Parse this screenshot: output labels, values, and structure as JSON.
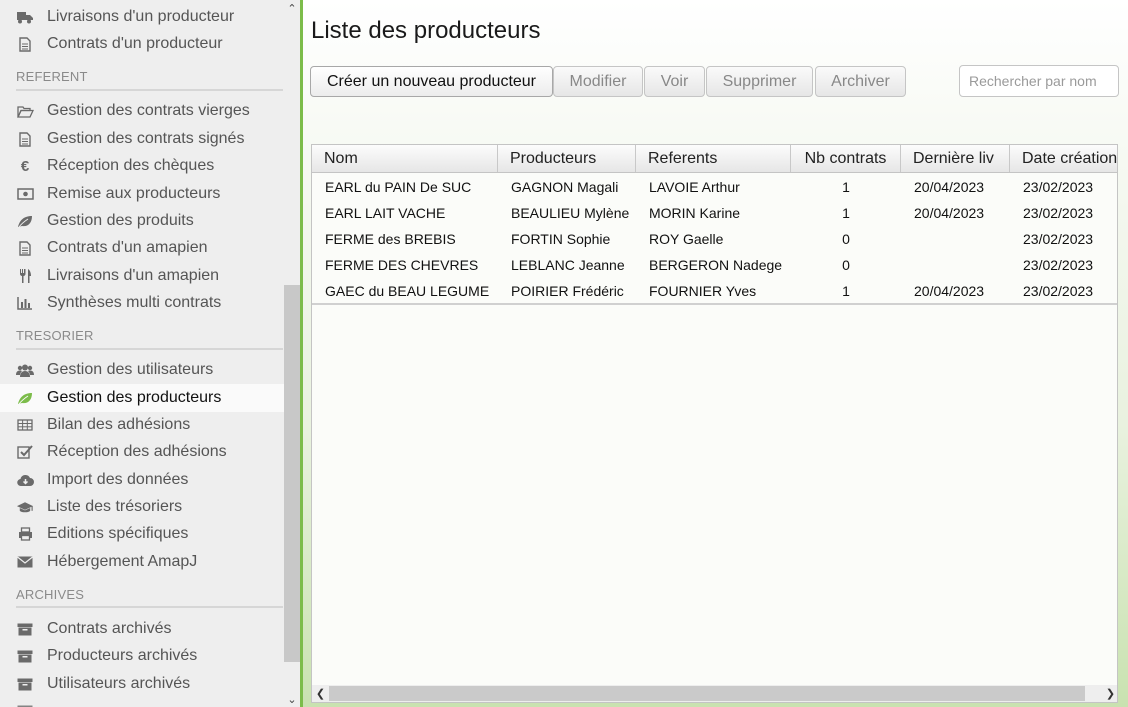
{
  "sidebar": {
    "top_items": [
      {
        "label": "Livraisons d'un producteur",
        "icon": "truck-icon"
      },
      {
        "label": "Contrats d'un producteur",
        "icon": "document-icon"
      }
    ],
    "sections": [
      {
        "title": "REFERENT",
        "items": [
          {
            "label": "Gestion des contrats vierges",
            "icon": "folder-open-icon"
          },
          {
            "label": "Gestion des contrats signés",
            "icon": "document-icon"
          },
          {
            "label": "Réception des chèques",
            "icon": "euro-icon"
          },
          {
            "label": "Remise aux producteurs",
            "icon": "money-icon"
          },
          {
            "label": "Gestion des produits",
            "icon": "leaf-icon"
          },
          {
            "label": "Contrats d'un amapien",
            "icon": "document-icon"
          },
          {
            "label": "Livraisons d'un amapien",
            "icon": "cutlery-icon"
          },
          {
            "label": "Synthèses multi contrats",
            "icon": "bar-chart-icon"
          }
        ]
      },
      {
        "title": "TRESORIER",
        "items": [
          {
            "label": "Gestion des utilisateurs",
            "icon": "users-icon"
          },
          {
            "label": "Gestion des producteurs",
            "icon": "leaf-icon",
            "active": true
          },
          {
            "label": "Bilan des adhésions",
            "icon": "table-icon"
          },
          {
            "label": "Réception des adhésions",
            "icon": "checkbox-icon"
          },
          {
            "label": "Import des données",
            "icon": "cloud-download-icon"
          },
          {
            "label": "Liste des trésoriers",
            "icon": "graduation-cap-icon"
          },
          {
            "label": "Editions spécifiques",
            "icon": "print-icon"
          },
          {
            "label": "Hébergement AmapJ",
            "icon": "envelope-icon"
          }
        ]
      },
      {
        "title": "ARCHIVES",
        "items": [
          {
            "label": "Contrats archivés",
            "icon": "archive-icon"
          },
          {
            "label": "Producteurs archivés",
            "icon": "archive-icon"
          },
          {
            "label": "Utilisateurs archivés",
            "icon": "archive-icon"
          }
        ]
      }
    ],
    "accent_color": "#7cbc4a"
  },
  "main": {
    "title": "Liste des producteurs",
    "buttons": {
      "create": "Créer un nouveau producteur",
      "edit": "Modifier",
      "view": "Voir",
      "delete": "Supprimer",
      "archive": "Archiver"
    },
    "search": {
      "placeholder": "Rechercher par nom",
      "value": ""
    },
    "table": {
      "columns": [
        "Nom",
        "Producteurs",
        "Referents",
        "Nb contrats",
        "Dernière liv",
        "Date création"
      ],
      "rows": [
        [
          "EARL du PAIN De SUC",
          "GAGNON Magali",
          "LAVOIE Arthur",
          "1",
          "20/04/2023",
          "23/02/2023"
        ],
        [
          "EARL LAIT VACHE",
          "BEAULIEU Mylène",
          "MORIN Karine",
          "1",
          "20/04/2023",
          "23/02/2023"
        ],
        [
          "FERME des BREBIS",
          "FORTIN Sophie",
          "ROY Gaelle",
          "0",
          "",
          "23/02/2023"
        ],
        [
          "FERME DES CHEVRES",
          "LEBLANC Jeanne",
          "BERGERON Nadege",
          "0",
          "",
          "23/02/2023"
        ],
        [
          "GAEC du BEAU LEGUME",
          "POIRIER Frédéric",
          "FOURNIER Yves",
          "1",
          "20/04/2023",
          "23/02/2023"
        ]
      ]
    }
  }
}
